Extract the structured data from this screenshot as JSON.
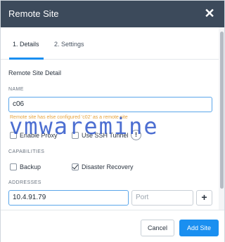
{
  "dialog": {
    "title": "Remote Site",
    "close_glyph": "✕"
  },
  "tabs": [
    {
      "label": "1. Details",
      "active": true
    },
    {
      "label": "2. Settings",
      "active": false
    }
  ],
  "form": {
    "section_title": "Remote Site Detail",
    "name_label": "NAME",
    "name_value": "c06",
    "name_warning": "Remote site has else configured 'c02' as a remote site",
    "enable_proxy_label": "Enable Proxy",
    "enable_proxy_checked": false,
    "ssh_tunnel_label": "Use SSH Tunnel",
    "ssh_tunnel_checked": false,
    "info_glyph": "!",
    "capabilities_label": "CAPABILITIES",
    "backup_label": "Backup",
    "backup_checked": false,
    "dr_label": "Disaster Recovery",
    "dr_checked": true,
    "addresses_label": "ADDRESSES",
    "address_value": "10.4.91.79",
    "port_placeholder": "Port",
    "add_address_glyph": "+"
  },
  "watermark": "vmwaremine",
  "footer": {
    "cancel_label": "Cancel",
    "submit_label": "Add Site"
  },
  "colors": {
    "header_bg": "#3c4a5b",
    "accent": "#1a8ff0",
    "warning": "#e6a33d",
    "watermark": "#2d55c9"
  }
}
